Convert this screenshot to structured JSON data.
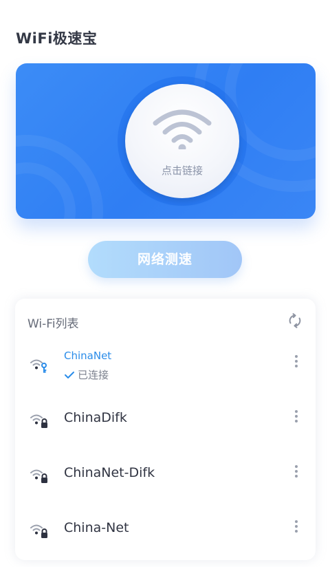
{
  "app": {
    "title": "WiFi极速宝"
  },
  "hero": {
    "connect_label": "点击链接",
    "accent_color": "#3c8cf6"
  },
  "speed_test": {
    "label": "网络测速"
  },
  "wifi_list": {
    "title": "Wi-Fi列表",
    "refresh_icon": "refresh-icon",
    "networks": [
      {
        "ssid": "ChinaNet",
        "status": "已连接",
        "connected": true,
        "icon": "wifi-key-icon"
      },
      {
        "ssid": "ChinaDifk",
        "status": "",
        "connected": false,
        "icon": "wifi-lock-icon"
      },
      {
        "ssid": "ChinaNet-Difk",
        "status": "",
        "connected": false,
        "icon": "wifi-lock-icon"
      },
      {
        "ssid": "China-Net",
        "status": "",
        "connected": false,
        "icon": "wifi-lock-icon"
      }
    ]
  }
}
